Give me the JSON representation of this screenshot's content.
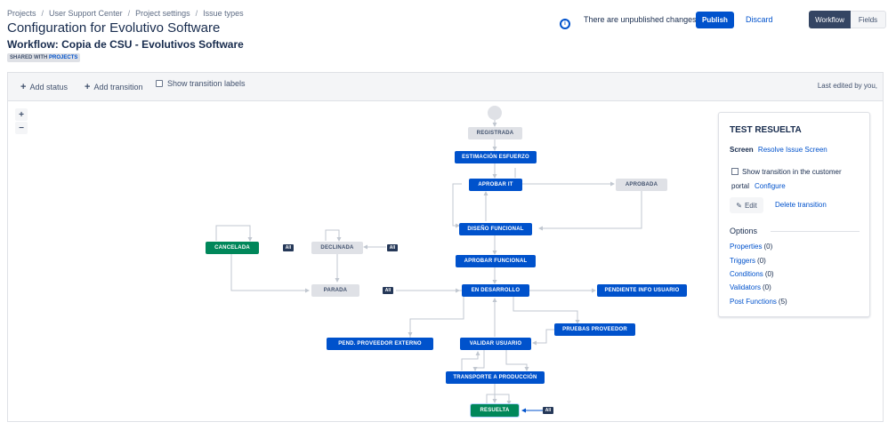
{
  "breadcrumb": [
    "Projects",
    "User Support Center",
    "Project settings",
    "Issue types"
  ],
  "page_title": "Configuration for Evolutivo Software",
  "workflow_title": "Workflow: Copia de CSU - Evolutivos Software",
  "shared_badge": {
    "prefix": "SHARED WITH",
    "link": "PROJECTS"
  },
  "header": {
    "info_icon": "info-icon",
    "unpublished_text": "There are unpublished changes.",
    "publish_label": "Publish",
    "discard_label": "Discard",
    "view_toggle": {
      "workflow": "Workflow",
      "fields": "Fields",
      "selected": "Workflow"
    }
  },
  "toolbar": {
    "add_status": "Add status",
    "add_transition": "Add transition",
    "show_labels": "Show transition labels",
    "show_labels_checked": false,
    "last_edited": "Last edited by you,"
  },
  "zoom": {
    "in": "+",
    "out": "−"
  },
  "diagram": {
    "statuses": {
      "registrada": "REGISTRADA",
      "estimacion": "ESTIMACIÓN ESFUERZO",
      "aprobar_it": "APROBAR IT",
      "aprobada": "APROBADA",
      "diseno": "DISEÑO FUNCIONAL",
      "aprobar_funcional": "APROBAR FUNCIONAL",
      "cancelada": "CANCELADA",
      "declinada": "DECLINADA",
      "parada": "PARADA",
      "en_desarrollo": "EN DESARROLLO",
      "pendiente_info": "PENDIENTE INFO USUARIO",
      "pruebas_proveedor": "PRUEBAS PROVEEDOR",
      "pend_proveedor": "PEND. PROVEEDOR EXTERNO",
      "validar_usuario": "VALIDAR USUARIO",
      "transporte": "TRANSPORTE A PRODUCCIÓN",
      "resuelta": "RESUELTA"
    },
    "all_label": "All",
    "colors": {
      "in_progress": "#0052cc",
      "todo": "#dfe1e6",
      "done": "#00875a",
      "line": "#c1c7d0"
    }
  },
  "panel": {
    "title": "TEST RESUELTA",
    "screen_label": "Screen",
    "screen_value": "Resolve Issue Screen",
    "portal_text": "Show transition in the customer portal",
    "portal_checked": false,
    "configure": "Configure",
    "edit": "Edit",
    "delete": "Delete transition",
    "options_heading": "Options",
    "options": [
      {
        "name": "Properties",
        "count": "(0)"
      },
      {
        "name": "Triggers",
        "count": "(0)"
      },
      {
        "name": "Conditions",
        "count": "(0)"
      },
      {
        "name": "Validators",
        "count": "(0)"
      },
      {
        "name": "Post Functions",
        "count": "(5)"
      }
    ]
  }
}
